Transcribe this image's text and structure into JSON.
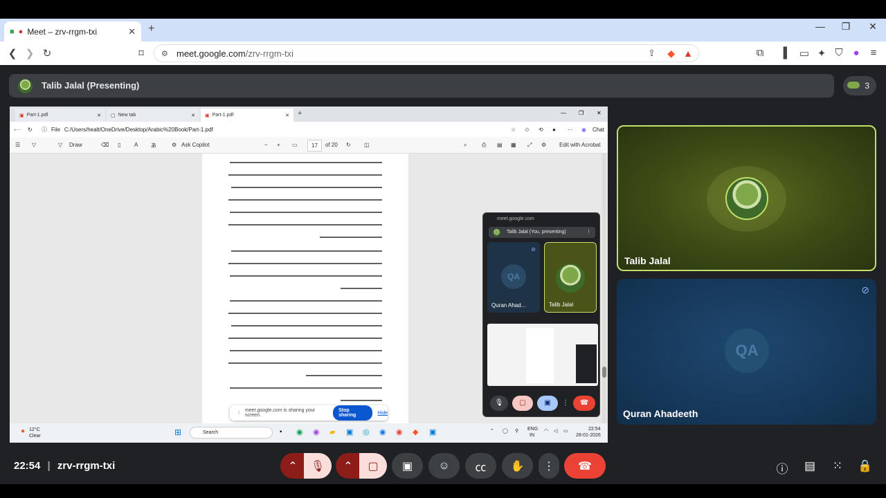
{
  "browser": {
    "tab_title": "Meet – zrv-rrgm-txi",
    "url_host": "meet.google.com",
    "url_path": "/zrv-rrgm-txi"
  },
  "meet": {
    "presenter_label": "Talib Jalal (Presenting)",
    "participant_count": "3",
    "meeting_time": "22:54",
    "meeting_code": "zrv-rrgm-txi",
    "tiles": [
      {
        "name": "Talib Jalal"
      },
      {
        "name": "Quran Ahadeeth"
      }
    ]
  },
  "shared_screen": {
    "tabs": [
      "Part-1.pdf",
      "New tab",
      "Part-1.pdf"
    ],
    "address_prefix": "File",
    "address": "C:/Users/healt/OneDrive/Desktop/Arabic%20Book/Part-1.pdf",
    "chat_label": "Chat",
    "pdf_toolbar": {
      "draw": "Draw",
      "ask_copilot": "Ask Copilot",
      "page_current": "17",
      "page_total": "of 20",
      "edit_acrobat": "Edit with Acrobat"
    },
    "share_notice": "meet.google.com is sharing your screen.",
    "stop_sharing": "Stop sharing",
    "hide": "Hide",
    "taskbar": {
      "weather_temp": "12°C",
      "weather_desc": "Clear",
      "search": "Search",
      "lang": "ENG",
      "region": "IN",
      "time": "22:54",
      "date": "28-01-2026"
    },
    "pip": {
      "host": "meet.google.com",
      "presenting": "Talib Jalal (You, presenting)",
      "tiles": [
        "Quran Ahad...",
        "Talib Jalal"
      ]
    }
  },
  "colors": {
    "accent_active_border": "#c2e06a",
    "end_call": "#ea4335",
    "muted_red": "#8c1d18"
  }
}
